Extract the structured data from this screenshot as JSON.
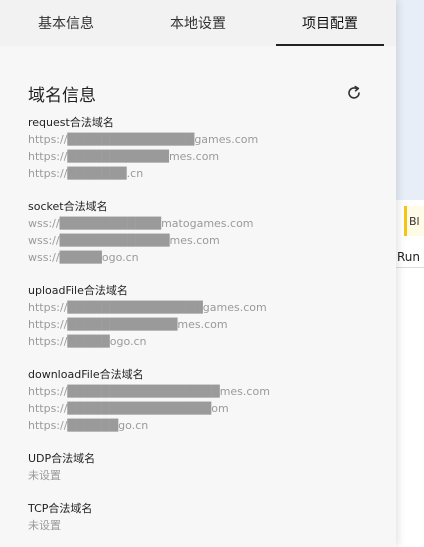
{
  "tabs": [
    "基本信息",
    "本地设置",
    "项目配置"
  ],
  "active_tab": 2,
  "section_title": "域名信息",
  "groups": [
    {
      "title": "request合法域名",
      "urls": [
        "https://███████████████games.com",
        "https://████████████mes.com",
        "https://███████.cn"
      ]
    },
    {
      "title": "socket合法域名",
      "urls": [
        "wss://████████████matogames.com",
        "wss://█████████████mes.com",
        "wss://█████ogo.cn"
      ]
    },
    {
      "title": "uploadFile合法域名",
      "urls": [
        "https://████████████████games.com",
        "https://█████████████mes.com",
        "https://█████ogo.cn"
      ]
    },
    {
      "title": "downloadFile合法域名",
      "urls": [
        "https://██████████████████mes.com",
        "https://█████████████████om",
        "https://██████go.cn"
      ]
    },
    {
      "title": "UDP合法域名",
      "urls": [
        "未设置"
      ]
    },
    {
      "title": "TCP合法域名",
      "urls": [
        "未设置"
      ]
    }
  ],
  "side": {
    "bl_label": "Bl",
    "run_label": "Run"
  }
}
